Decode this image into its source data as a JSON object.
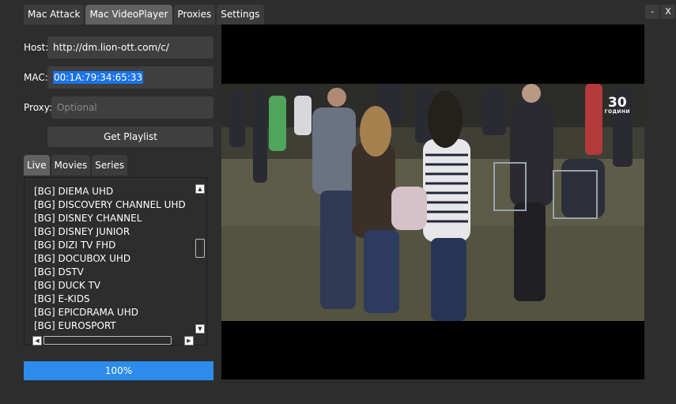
{
  "tabs": [
    {
      "label": "Mac Attack",
      "active": false
    },
    {
      "label": "Mac VideoPlayer",
      "active": true
    },
    {
      "label": "Proxies",
      "active": false
    },
    {
      "label": "Settings",
      "active": false
    }
  ],
  "window": {
    "minimize_label": "-",
    "close_label": "X"
  },
  "form": {
    "host_label": "Host:",
    "host_value": "http://dm.lion-ott.com/c/",
    "mac_label": "MAC:",
    "mac_value": "00:1A:79:34:65:33",
    "proxy_label": "Proxy:",
    "proxy_placeholder": "Optional",
    "get_playlist_label": "Get Playlist"
  },
  "playlist_tabs": [
    {
      "label": "Live",
      "active": true
    },
    {
      "label": "Movies",
      "active": false
    },
    {
      "label": "Series",
      "active": false
    }
  ],
  "channels": [
    "[BG] DIEMA UHD",
    "[BG] DISCOVERY CHANNEL UHD",
    "[BG] DISNEY CHANNEL",
    "[BG] DISNEY JUNIOR",
    "[BG] DIZI TV FHD",
    "[BG] DOCUBOX UHD",
    "[BG] DSTV",
    "[BG] DUCK TV",
    "[BG] E-KIDS",
    "[BG] EPICDRAMA UHD",
    "[BG] EUROSPORT"
  ],
  "progress": {
    "value": 1.0,
    "label": "100%"
  },
  "video": {
    "logo_number": "30",
    "logo_word": "ГОДИНИ",
    "colors": {
      "accent": "#2d8ceb",
      "selection": "#1a73e8",
      "background": "#2d2d2d"
    }
  }
}
